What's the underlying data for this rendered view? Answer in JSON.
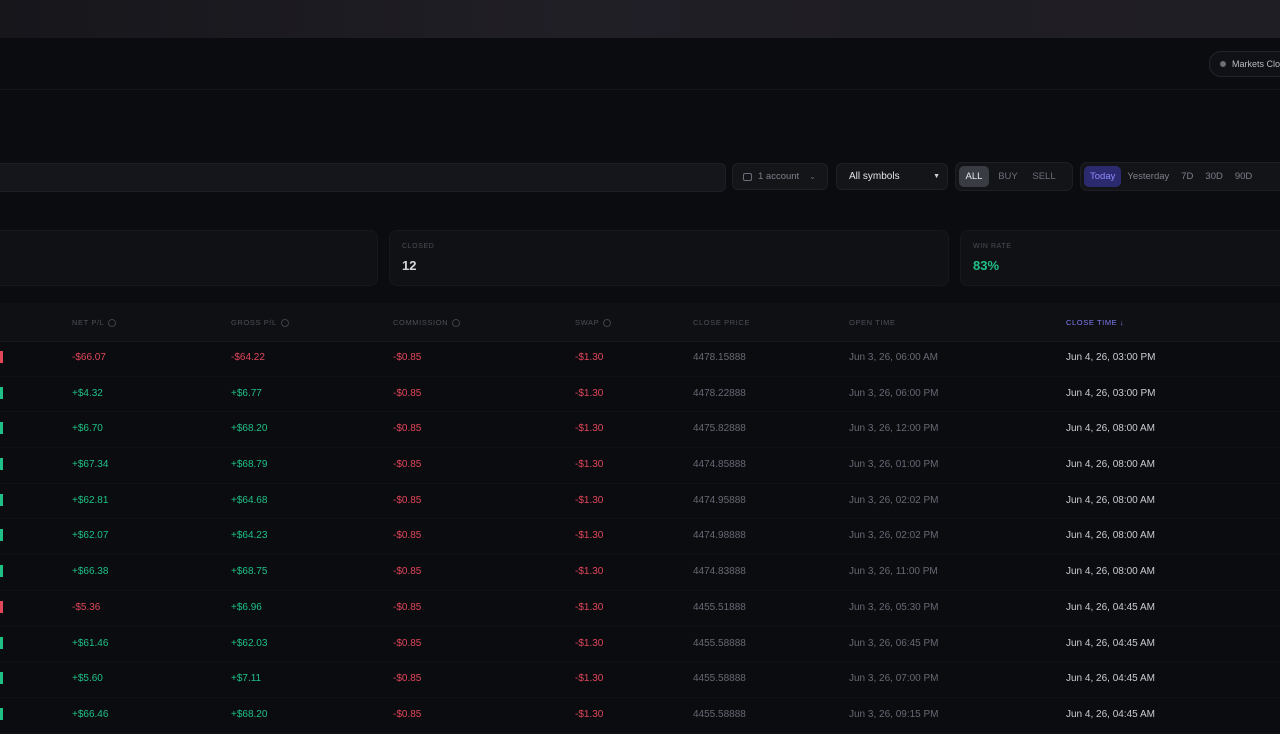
{
  "header": {
    "market_status": "Markets Clo"
  },
  "filters": {
    "accounts": "1 account",
    "symbol": "All symbols",
    "side_options": [
      "ALL",
      "BUY",
      "SELL"
    ],
    "side_active": "ALL",
    "ranges": [
      "Today",
      "Yesterday",
      "7D",
      "30D",
      "90D"
    ],
    "range_active": "Today"
  },
  "stats": {
    "closed_label": "CLOSED",
    "closed_value": "12",
    "winrate_label": "WIN RATE",
    "winrate_value": "83%",
    "win_color": "#1fc186",
    "loss_color": "#e1465a"
  },
  "table": {
    "headers": {
      "net_pl": "NET P/L",
      "gross_pl": "GROSS P/L",
      "commission": "COMMISSION",
      "swap": "SWAP",
      "close_price": "CLOSE PRICE",
      "open_time": "OPEN TIME",
      "close_time": "CLOSE TIME ↓"
    },
    "rows": [
      {
        "net_pl": "-$66.07",
        "gross_pl": "-$64.22",
        "commission": "-$0.85",
        "swap": "-$1.30",
        "close_price": "4478.15888",
        "open_time": "Jun 3, 26, 06:00 AM",
        "close_time": "Jun 4, 26, 03:00 PM"
      },
      {
        "net_pl": "+$4.32",
        "gross_pl": "+$6.77",
        "commission": "-$0.85",
        "swap": "-$1.30",
        "close_price": "4478.22888",
        "open_time": "Jun 3, 26, 06:00 PM",
        "close_time": "Jun 4, 26, 03:00 PM"
      },
      {
        "net_pl": "+$6.70",
        "gross_pl": "+$68.20",
        "commission": "-$0.85",
        "swap": "-$1.30",
        "close_price": "4475.82888",
        "open_time": "Jun 3, 26, 12:00 PM",
        "close_time": "Jun 4, 26, 08:00 AM"
      },
      {
        "net_pl": "+$67.34",
        "gross_pl": "+$68.79",
        "commission": "-$0.85",
        "swap": "-$1.30",
        "close_price": "4474.85888",
        "open_time": "Jun 3, 26, 01:00 PM",
        "close_time": "Jun 4, 26, 08:00 AM"
      },
      {
        "net_pl": "+$62.81",
        "gross_pl": "+$64.68",
        "commission": "-$0.85",
        "swap": "-$1.30",
        "close_price": "4474.95888",
        "open_time": "Jun 3, 26, 02:02 PM",
        "close_time": "Jun 4, 26, 08:00 AM"
      },
      {
        "net_pl": "+$62.07",
        "gross_pl": "+$64.23",
        "commission": "-$0.85",
        "swap": "-$1.30",
        "close_price": "4474.98888",
        "open_time": "Jun 3, 26, 02:02 PM",
        "close_time": "Jun 4, 26, 08:00 AM"
      },
      {
        "net_pl": "+$66.38",
        "gross_pl": "+$68.75",
        "commission": "-$0.85",
        "swap": "-$1.30",
        "close_price": "4474.83888",
        "open_time": "Jun 3, 26, 11:00 PM",
        "close_time": "Jun 4, 26, 08:00 AM"
      },
      {
        "net_pl": "-$5.36",
        "gross_pl": "+$6.96",
        "commission": "-$0.85",
        "swap": "-$1.30",
        "close_price": "4455.51888",
        "open_time": "Jun 3, 26, 05:30 PM",
        "close_time": "Jun 4, 26, 04:45 AM"
      },
      {
        "net_pl": "+$61.46",
        "gross_pl": "+$62.03",
        "commission": "-$0.85",
        "swap": "-$1.30",
        "close_price": "4455.58888",
        "open_time": "Jun 3, 26, 06:45 PM",
        "close_time": "Jun 4, 26, 04:45 AM"
      },
      {
        "net_pl": "+$5.60",
        "gross_pl": "+$7.11",
        "commission": "-$0.85",
        "swap": "-$1.30",
        "close_price": "4455.58888",
        "open_time": "Jun 3, 26, 07:00 PM",
        "close_time": "Jun 4, 26, 04:45 AM"
      },
      {
        "net_pl": "+$66.46",
        "gross_pl": "+$68.20",
        "commission": "-$0.85",
        "swap": "-$1.30",
        "close_price": "4455.58888",
        "open_time": "Jun 3, 26, 09:15 PM",
        "close_time": "Jun 4, 26, 04:45 AM"
      }
    ]
  }
}
